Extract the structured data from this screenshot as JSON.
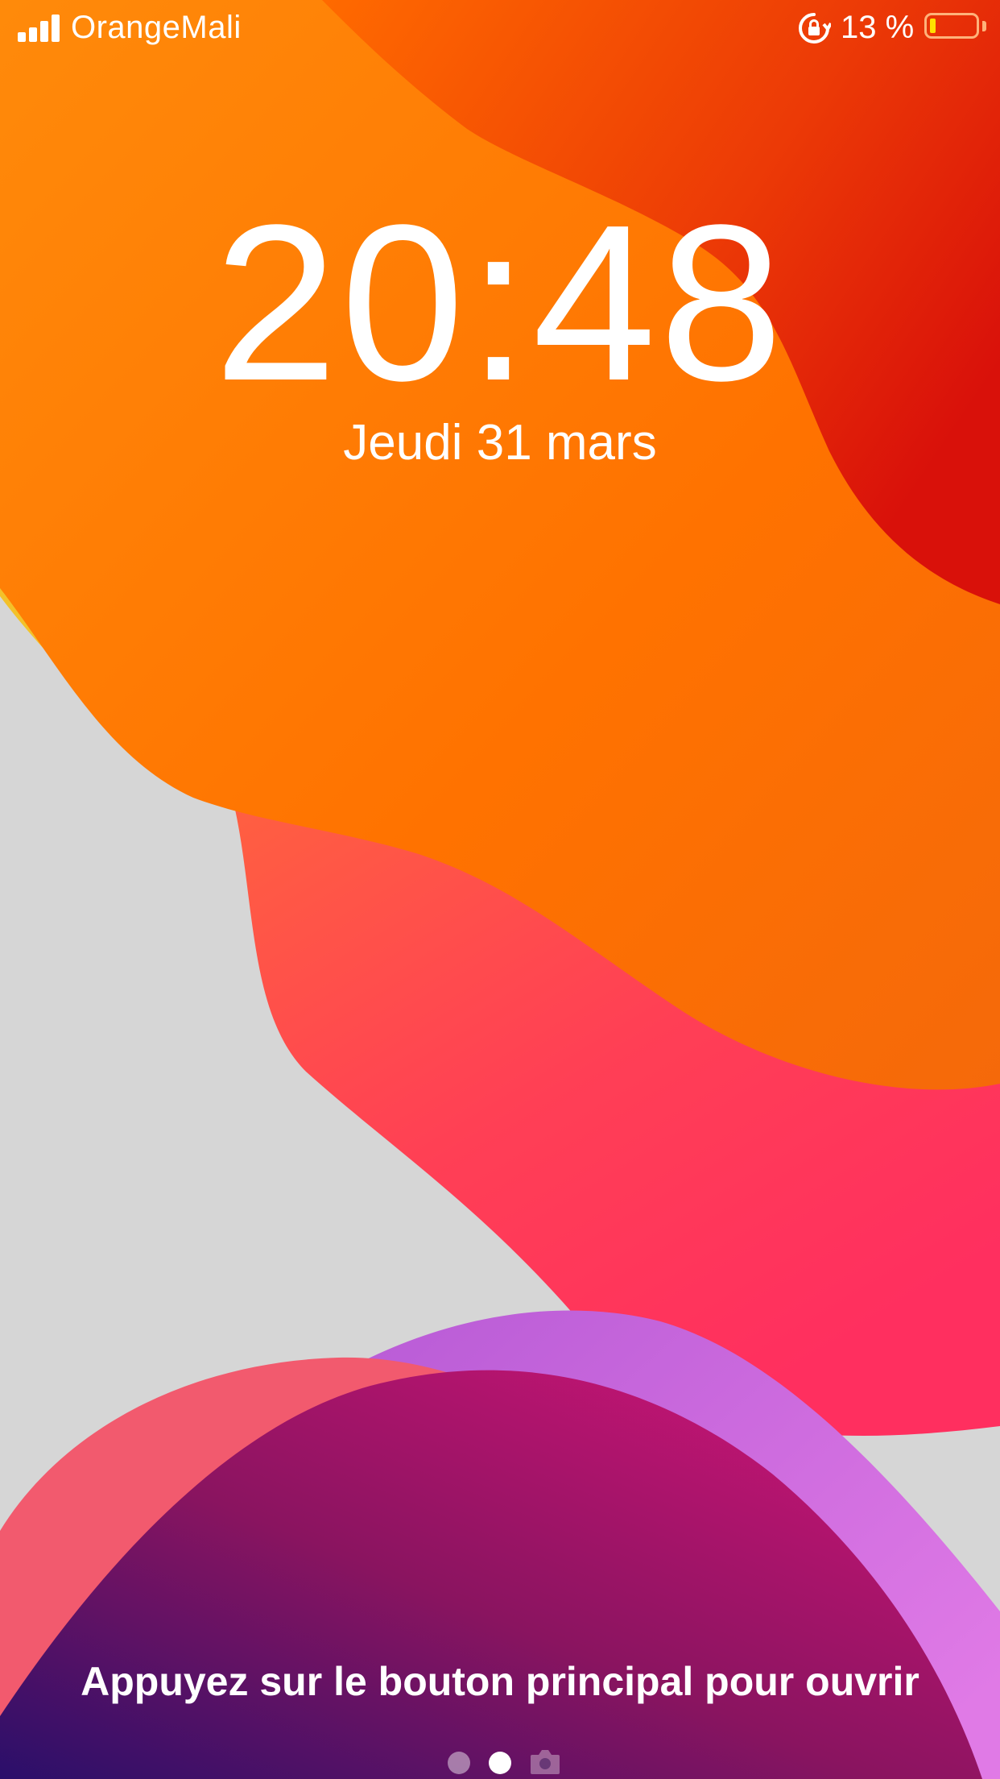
{
  "status_bar": {
    "carrier": "OrangeMali",
    "battery_percent": "13 %",
    "battery_level": 0.13,
    "icons": [
      "signal-icon",
      "orientation-lock-icon",
      "battery-icon"
    ]
  },
  "lock_screen": {
    "time": "20:48",
    "date": "Jeudi 31 mars",
    "unlock_hint": "Appuyez sur le bouton principal pour ouvrir"
  },
  "page_indicator": {
    "pages": 2,
    "current": 2,
    "trailing_icon": "camera-icon"
  },
  "colors": {
    "orange": "#ff7a00",
    "red": "#e2230a",
    "yellow": "#f2c72d",
    "pink_red": "#ff3a5c",
    "magenta": "#c2176a",
    "purple": "#d873e0",
    "background_grey": "#d6d6d6"
  }
}
